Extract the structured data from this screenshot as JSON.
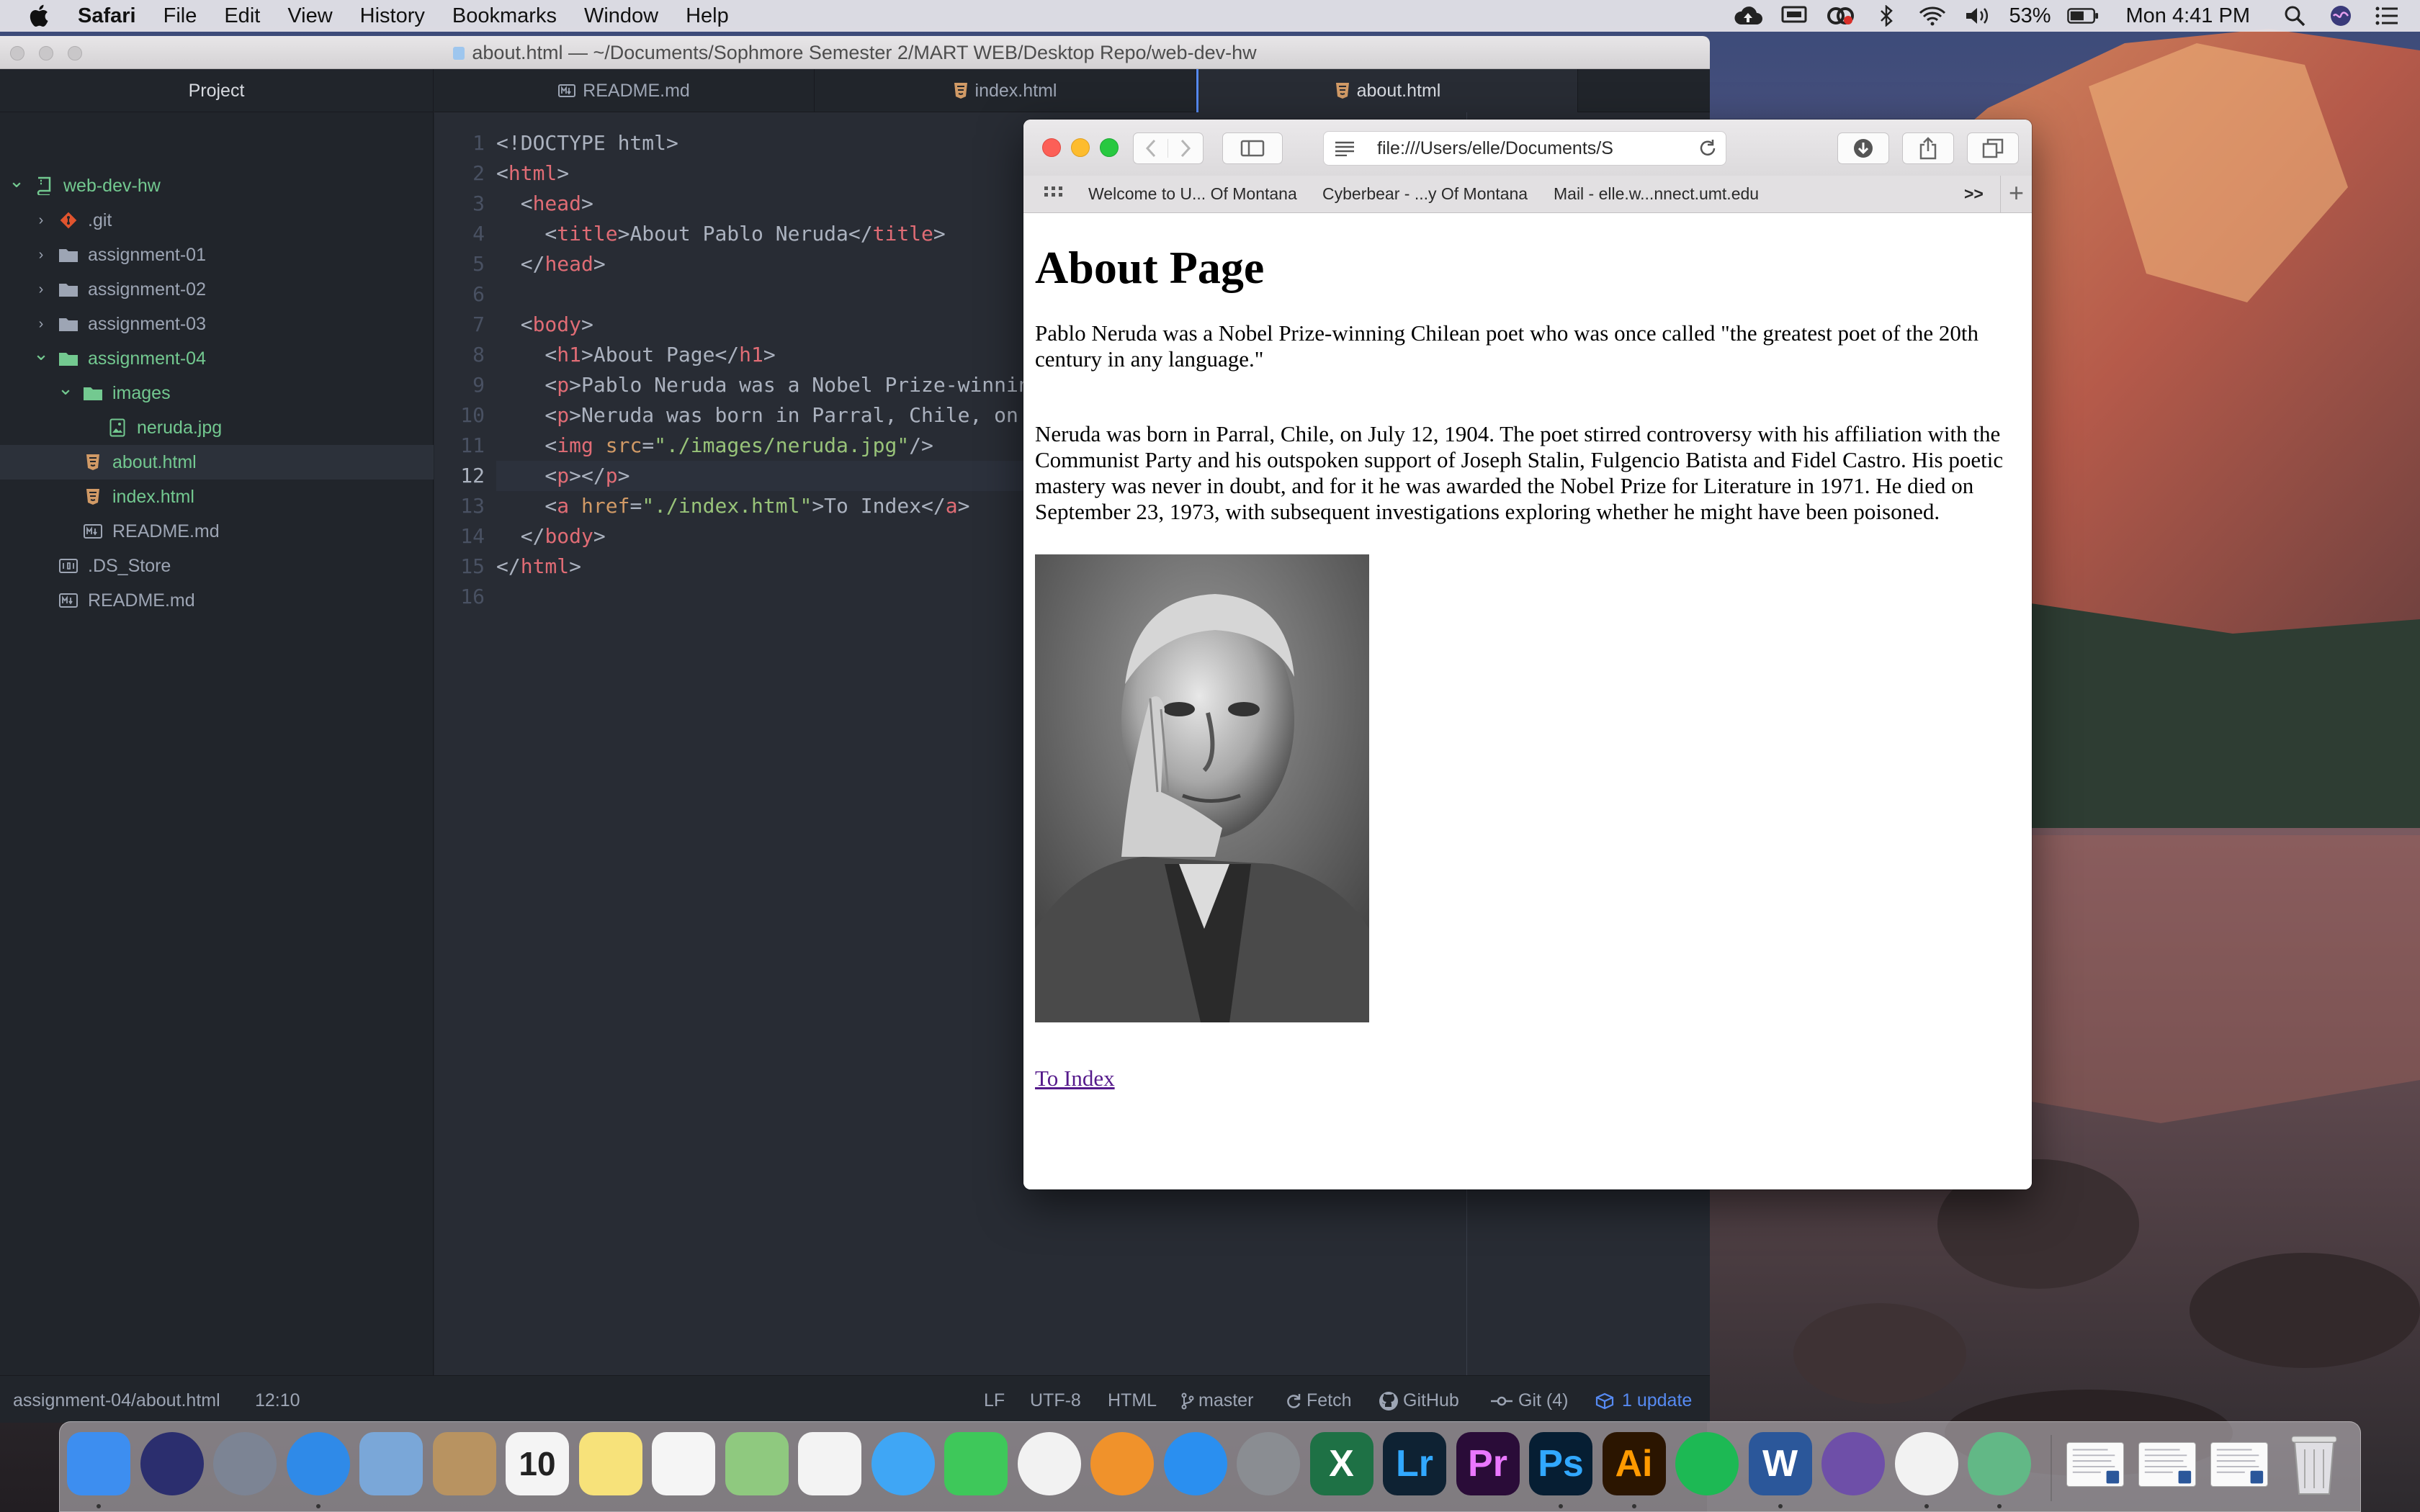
{
  "menubar": {
    "app": "Safari",
    "items": [
      "File",
      "Edit",
      "View",
      "History",
      "Bookmarks",
      "Window",
      "Help"
    ],
    "battery": "53%",
    "clock": "Mon 4:41 PM"
  },
  "atom": {
    "window_title": "about.html — ~/Documents/Sophmore Semester 2/MART WEB/Desktop Repo/web-dev-hw",
    "tree_header": "Project",
    "tree": [
      {
        "label": "web-dev-hw",
        "icon": "repo-icon",
        "depth": 0,
        "chevron": "open",
        "color": "green"
      },
      {
        "label": ".git",
        "icon": "git-icon",
        "depth": 1,
        "chevron": "closed",
        "color": "normal"
      },
      {
        "label": "assignment-01",
        "icon": "folder-icon",
        "depth": 1,
        "chevron": "closed",
        "color": "normal"
      },
      {
        "label": "assignment-02",
        "icon": "folder-icon",
        "depth": 1,
        "chevron": "closed",
        "color": "normal"
      },
      {
        "label": "assignment-03",
        "icon": "folder-icon",
        "depth": 1,
        "chevron": "closed",
        "color": "normal"
      },
      {
        "label": "assignment-04",
        "icon": "folder-icon",
        "depth": 1,
        "chevron": "open",
        "color": "green"
      },
      {
        "label": "images",
        "icon": "folder-icon",
        "depth": 2,
        "chevron": "open",
        "color": "green"
      },
      {
        "label": "neruda.jpg",
        "icon": "image-file-icon",
        "depth": 3,
        "chevron": "none",
        "color": "green"
      },
      {
        "label": "about.html",
        "icon": "html-file-icon",
        "depth": 2,
        "chevron": "none",
        "color": "green",
        "selected": true
      },
      {
        "label": "index.html",
        "icon": "html-file-icon",
        "depth": 2,
        "chevron": "none",
        "color": "green"
      },
      {
        "label": "README.md",
        "icon": "markdown-file-icon",
        "depth": 2,
        "chevron": "none",
        "color": "normal"
      },
      {
        "label": ".DS_Store",
        "icon": "binary-file-icon",
        "depth": 1,
        "chevron": "none",
        "color": "normal"
      },
      {
        "label": "README.md",
        "icon": "markdown-file-icon",
        "depth": 1,
        "chevron": "none",
        "color": "normal"
      }
    ],
    "tabs": [
      {
        "label": "README.md",
        "icon": "markdown-file-icon",
        "active": false
      },
      {
        "label": "index.html",
        "icon": "html-file-icon",
        "active": false
      },
      {
        "label": "about.html",
        "icon": "html-file-icon",
        "active": true
      }
    ],
    "current_line": 12,
    "code": [
      [
        [
          "t",
          "<!DOCTYPE html>"
        ]
      ],
      [
        [
          "t",
          "<"
        ],
        [
          "g",
          "html"
        ],
        [
          "t",
          ">"
        ]
      ],
      [
        [
          "t",
          "  <"
        ],
        [
          "g",
          "head"
        ],
        [
          "t",
          ">"
        ]
      ],
      [
        [
          "t",
          "    <"
        ],
        [
          "g",
          "title"
        ],
        [
          "t",
          ">About Pablo Neruda</"
        ],
        [
          "g",
          "title"
        ],
        [
          "t",
          ">"
        ]
      ],
      [
        [
          "t",
          "  </"
        ],
        [
          "g",
          "head"
        ],
        [
          "t",
          ">"
        ]
      ],
      [],
      [
        [
          "t",
          "  <"
        ],
        [
          "g",
          "body"
        ],
        [
          "t",
          ">"
        ]
      ],
      [
        [
          "t",
          "    <"
        ],
        [
          "g",
          "h1"
        ],
        [
          "t",
          ">About Page</"
        ],
        [
          "g",
          "h1"
        ],
        [
          "t",
          ">"
        ]
      ],
      [
        [
          "t",
          "    <"
        ],
        [
          "g",
          "p"
        ],
        [
          "t",
          ">Pablo Neruda was a Nobel Prize-winning Chilean poet who was once called \"the greatest poet of the 20th century in any language.\"</"
        ],
        [
          "g",
          "p"
        ],
        [
          "t",
          ">"
        ]
      ],
      [
        [
          "t",
          "    <"
        ],
        [
          "g",
          "p"
        ],
        [
          "t",
          ">Neruda was born in Parral, Chile, on July 12, 1904.</"
        ],
        [
          "g",
          "p"
        ],
        [
          "t",
          ">"
        ]
      ],
      [
        [
          "t",
          "    <"
        ],
        [
          "g",
          "img"
        ],
        [
          "t",
          " "
        ],
        [
          "a",
          "src"
        ],
        [
          "t",
          "="
        ],
        [
          "s",
          "\"./images/neruda.jpg\""
        ],
        [
          "t",
          "/>"
        ]
      ],
      [
        [
          "t",
          "    <"
        ],
        [
          "g",
          "p"
        ],
        [
          "t",
          "></"
        ],
        [
          "g",
          "p"
        ],
        [
          "t",
          ">"
        ]
      ],
      [
        [
          "t",
          "    <"
        ],
        [
          "g",
          "a"
        ],
        [
          "t",
          " "
        ],
        [
          "a",
          "href"
        ],
        [
          "t",
          "="
        ],
        [
          "s",
          "\"./index.html\""
        ],
        [
          "t",
          ">To Index</"
        ],
        [
          "g",
          "a"
        ],
        [
          "t",
          ">"
        ]
      ],
      [
        [
          "t",
          "  </"
        ],
        [
          "g",
          "body"
        ],
        [
          "t",
          ">"
        ]
      ],
      [
        [
          "t",
          "</"
        ],
        [
          "g",
          "html"
        ],
        [
          "t",
          ">"
        ]
      ],
      []
    ],
    "status": {
      "path": "assignment-04/about.html",
      "cursor": "12:10",
      "line_ending": "LF",
      "encoding": "UTF-8",
      "grammar": "HTML",
      "branch": "master",
      "fetch": "Fetch",
      "github": "GitHub",
      "git": "Git (4)",
      "update": "1 update"
    }
  },
  "safari": {
    "address": "file:///Users/elle/Documents/S",
    "favorites": [
      "Welcome to U... Of Montana",
      "Cyberbear - ...y Of Montana",
      "Mail - elle.w...nnect.umt.edu"
    ],
    "page": {
      "heading": "About Page",
      "para1": "Pablo Neruda was a Nobel Prize-winning Chilean poet who was once called \"the greatest poet of the 20th century in any language.\"",
      "para2": "Neruda was born in Parral, Chile, on July 12, 1904. The poet stirred controversy with his affiliation with the Communist Party and his outspoken support of Joseph Stalin, Fulgencio Batista and Fidel Castro. His poetic mastery was never in doubt, and for it he was awarded the Nobel Prize for Literature in 1971. He died on September 23, 1973, with subsequent investigations exploring whether he might have been poisoned.",
      "link": "To Index"
    }
  },
  "dock": {
    "apps": [
      {
        "name": "Finder",
        "icon": "finder-icon",
        "color": "#3d8ef0",
        "label": "",
        "running": true
      },
      {
        "name": "Siri",
        "icon": "siri-icon",
        "color": "#2b2e6e",
        "label": "",
        "running": false
      },
      {
        "name": "Launchpad",
        "icon": "launchpad-icon",
        "color": "#7c8494",
        "label": "",
        "running": false
      },
      {
        "name": "Safari",
        "icon": "safari-icon",
        "color": "#2f8ae8",
        "label": "",
        "running": true
      },
      {
        "name": "Mail",
        "icon": "mail-icon",
        "color": "#7aa7d8",
        "label": "",
        "running": false
      },
      {
        "name": "Contacts",
        "icon": "contacts-icon",
        "color": "#b89361",
        "label": "",
        "running": false
      },
      {
        "name": "Calendar",
        "icon": "calendar-icon",
        "color": "#f4f4f4",
        "label": "10",
        "running": false
      },
      {
        "name": "Notes",
        "icon": "notes-icon",
        "color": "#f7e27a",
        "label": "",
        "running": false
      },
      {
        "name": "Reminders",
        "icon": "reminders-icon",
        "color": "#f5f5f5",
        "label": "",
        "running": false
      },
      {
        "name": "Maps",
        "icon": "maps-icon",
        "color": "#8fc97f",
        "label": "",
        "running": false
      },
      {
        "name": "Photos",
        "icon": "photos-icon",
        "color": "#f3f3f3",
        "label": "",
        "running": false
      },
      {
        "name": "Messages",
        "icon": "messages-icon",
        "color": "#3fa6f5",
        "label": "",
        "running": false
      },
      {
        "name": "FaceTime",
        "icon": "facetime-icon",
        "color": "#3ec85a",
        "label": "",
        "running": false
      },
      {
        "name": "iTunes",
        "icon": "itunes-icon",
        "color": "#f2f2f2",
        "label": "",
        "running": false
      },
      {
        "name": "iBooks",
        "icon": "ibooks-icon",
        "color": "#f0922b",
        "label": "",
        "running": false
      },
      {
        "name": "App Store",
        "icon": "app-store-icon",
        "color": "#2a8ff0",
        "label": "",
        "running": false
      },
      {
        "name": "System Preferences",
        "icon": "system-preferences-icon",
        "color": "#8a8d92",
        "label": "",
        "running": false
      },
      {
        "name": "Excel",
        "icon": "excel-icon",
        "color": "#1e7145",
        "label": "X",
        "running": false
      },
      {
        "name": "Lightroom",
        "icon": "lightroom-icon",
        "color": "#0e2233",
        "label": "Lr",
        "running": false
      },
      {
        "name": "Premiere",
        "icon": "premiere-icon",
        "color": "#2a0c38",
        "label": "Pr",
        "running": false
      },
      {
        "name": "Photoshop",
        "icon": "photoshop-icon",
        "color": "#061e33",
        "label": "Ps",
        "running": true
      },
      {
        "name": "Illustrator",
        "icon": "illustrator-icon",
        "color": "#2b1500",
        "label": "Ai",
        "running": true
      },
      {
        "name": "Spotify",
        "icon": "spotify-icon",
        "color": "#1db954",
        "label": "",
        "running": false
      },
      {
        "name": "Word",
        "icon": "word-icon",
        "color": "#2b579a",
        "label": "W",
        "running": true
      },
      {
        "name": "GitHub Desktop",
        "icon": "github-desktop-icon",
        "color": "#6e4fa8",
        "label": "",
        "running": false
      },
      {
        "name": "Chrome",
        "icon": "chrome-icon",
        "color": "#f2f2f2",
        "label": "",
        "running": true
      },
      {
        "name": "Atom",
        "icon": "atom-icon",
        "color": "#62b886",
        "label": "",
        "running": true
      }
    ],
    "docs": [
      {
        "icon": "document-thumbnail-icon"
      },
      {
        "icon": "document-thumbnail-icon"
      },
      {
        "icon": "document-thumbnail-icon"
      },
      {
        "icon": "trash-icon"
      }
    ]
  },
  "colors": {
    "atom_bg": "#282c34",
    "tree_bg": "#21252b",
    "git_green": "#73c990",
    "accent_blue": "#568af2",
    "html_tag": "#e06c75",
    "html_attr": "#d19a66",
    "html_string": "#98c379"
  }
}
